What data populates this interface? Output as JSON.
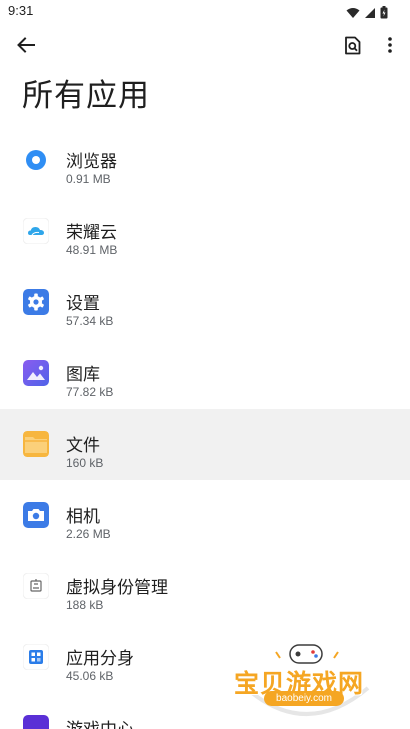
{
  "status_bar": {
    "time": "9:31",
    "icons": [
      "wifi-icon",
      "signal-icon",
      "battery-icon"
    ]
  },
  "app_bar": {
    "back_icon": "arrow-left-icon",
    "search_icon": "search-doc-icon",
    "more_icon": "more-vert-icon"
  },
  "page": {
    "title": "所有应用"
  },
  "apps": [
    {
      "name": "浏览器",
      "size": "0.91 MB",
      "icon": "browser-icon",
      "color": "#2f8ef4",
      "selected": false
    },
    {
      "name": "荣耀云",
      "size": "48.91 MB",
      "icon": "cloud-icon",
      "color": "#2b7de9",
      "selected": false
    },
    {
      "name": "设置",
      "size": "57.34 kB",
      "icon": "settings-gear-icon",
      "color": "#3c7be6",
      "selected": false
    },
    {
      "name": "图库",
      "size": "77.82 kB",
      "icon": "gallery-icon",
      "color": "#6b5ce7",
      "selected": false
    },
    {
      "name": "文件",
      "size": "160 kB",
      "icon": "folder-icon",
      "color": "#f7b63f",
      "selected": true
    },
    {
      "name": "相机",
      "size": "2.26 MB",
      "icon": "camera-icon",
      "color": "#3c7be6",
      "selected": false
    },
    {
      "name": "虚拟身份管理",
      "size": "188 kB",
      "icon": "identity-icon",
      "color": "#666666",
      "selected": false
    },
    {
      "name": "应用分身",
      "size": "45.06 kB",
      "icon": "app-clone-icon",
      "color": "#2b7de9",
      "selected": false
    },
    {
      "name": "游戏中心",
      "size": "",
      "icon": "game-center-icon",
      "color": "#5a2fd6",
      "selected": false
    }
  ],
  "watermark": {
    "text": "宝贝游戏网",
    "url": "baobeiy.com",
    "color": "#f5a623"
  }
}
